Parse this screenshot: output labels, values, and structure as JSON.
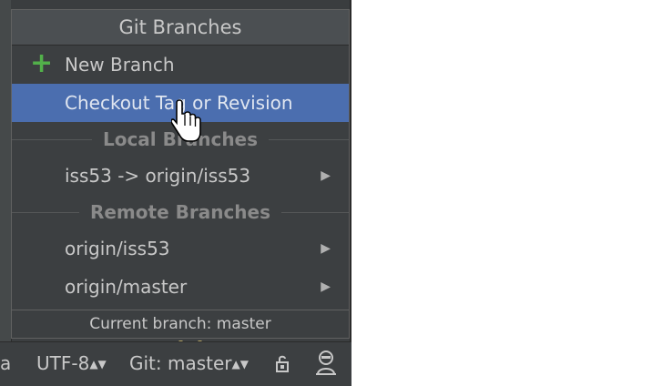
{
  "popup": {
    "title": "Git Branches",
    "new_branch_label": "New Branch",
    "checkout_label": "Checkout Tag or Revision",
    "local_header": "Local Branches",
    "local_branches": [
      "iss53 -> origin/iss53"
    ],
    "remote_header": "Remote Branches",
    "remote_branches": [
      "origin/iss53",
      "origin/master"
    ],
    "footer": "Current branch: master"
  },
  "statusbar": {
    "truncated_left": "a",
    "encoding": "UTF-8",
    "git_branch": "Git: master"
  },
  "icons": {
    "plus": "plus-icon",
    "submenu_arrow": "chevron-right-icon",
    "lock": "lock-icon",
    "inspector": "hector-icon",
    "cursor": "hand-pointer-cursor"
  },
  "colors": {
    "selection": "#4b6eaf",
    "plus": "#52b04a",
    "background": "#3c3f41"
  }
}
